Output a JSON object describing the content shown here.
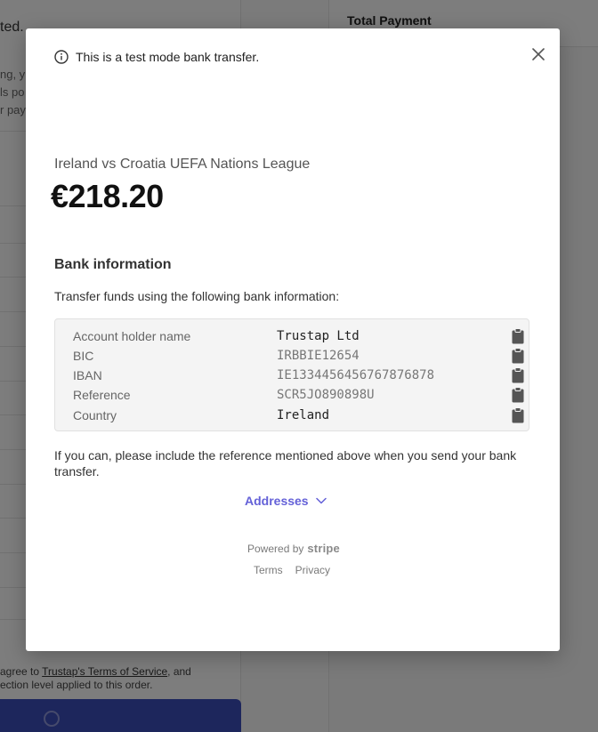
{
  "background": {
    "heading_fragment": "ted.",
    "snippets": [
      "ng, y",
      "ls po",
      "r pay"
    ],
    "total_payment_label": "Total Payment",
    "terms_prefix": " agree to ",
    "terms_link": "Trustap's Terms of Service",
    "terms_suffix": ", and",
    "terms_line2": "ection level applied to this order."
  },
  "modal": {
    "test_mode_text": "This is a test mode bank transfer.",
    "merchant_title": "Ireland vs Croatia UEFA Nations League",
    "amount": "€218.20",
    "section_title": "Bank information",
    "instructions": "Transfer funds using the following bank information:",
    "bank_rows": [
      {
        "label": "Account holder name",
        "value": "Trustap Ltd"
      },
      {
        "label": "BIC",
        "value": "IRBBIE12654"
      },
      {
        "label": "IBAN",
        "value": "IE1334456456767876878"
      },
      {
        "label": "Reference",
        "value": "SCR5JO890898U"
      },
      {
        "label": "Country",
        "value": "Ireland"
      }
    ],
    "reference_note": "If you can, please include the reference mentioned above when you send your bank transfer.",
    "addresses_label": "Addresses",
    "powered_by": "Powered by",
    "stripe_word": "stripe",
    "footer_links": {
      "terms": "Terms",
      "privacy": "Privacy"
    }
  },
  "colors": {
    "accent": "#6461d8",
    "pay_button": "#3b4cb8"
  },
  "icons": {
    "info": "info-circle-icon",
    "close": "close-x-icon",
    "copy": "clipboard-icon",
    "chevron": "chevron-down-icon"
  }
}
